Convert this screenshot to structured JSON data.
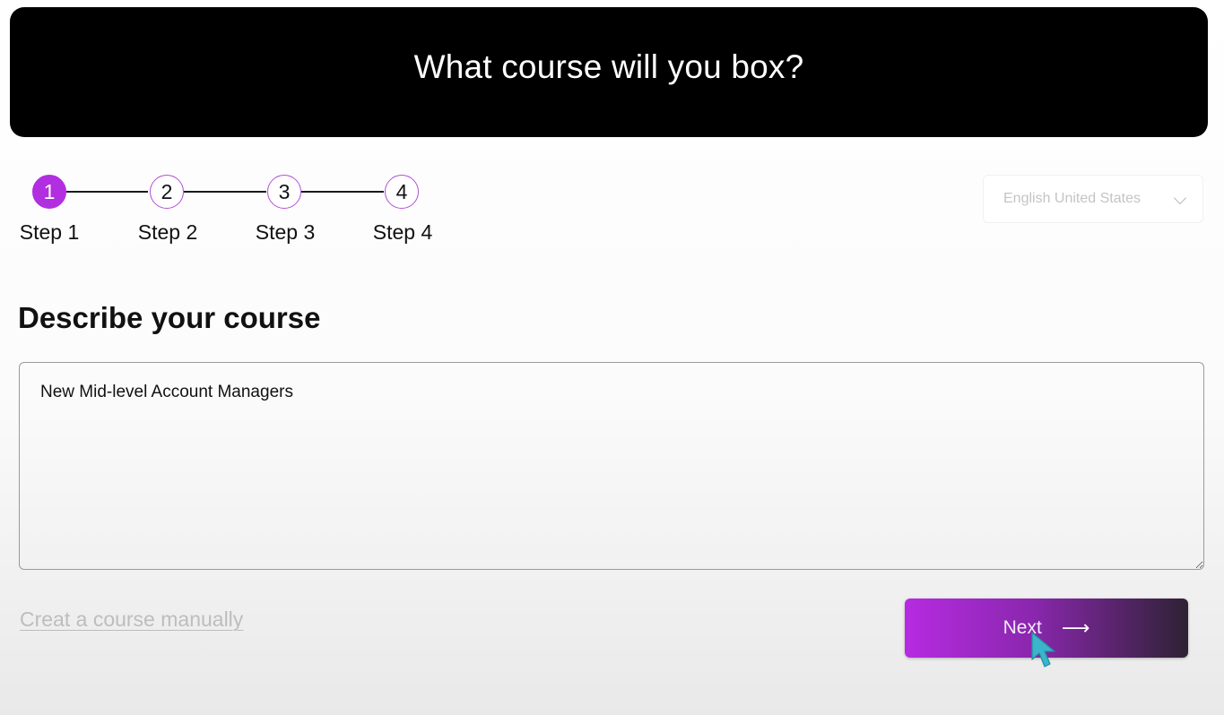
{
  "header": {
    "title": "What course will you box?"
  },
  "stepper": {
    "steps": [
      {
        "number": "1",
        "label": "Step 1",
        "active": true
      },
      {
        "number": "2",
        "label": "Step 2",
        "active": false
      },
      {
        "number": "3",
        "label": "Step 3",
        "active": false
      },
      {
        "number": "4",
        "label": "Step 4",
        "active": false
      }
    ]
  },
  "language": {
    "selected": "English United States"
  },
  "course": {
    "section_title": "Describe your course",
    "description_value": "New Mid-level Account Managers"
  },
  "actions": {
    "manual_link": "Creat a course manually",
    "next_label": "Next",
    "next_icon": "arrow-right-icon"
  },
  "colors": {
    "accent": "#b12fe0",
    "header_bg": "#000000",
    "cursor": "#3ab5c9"
  }
}
